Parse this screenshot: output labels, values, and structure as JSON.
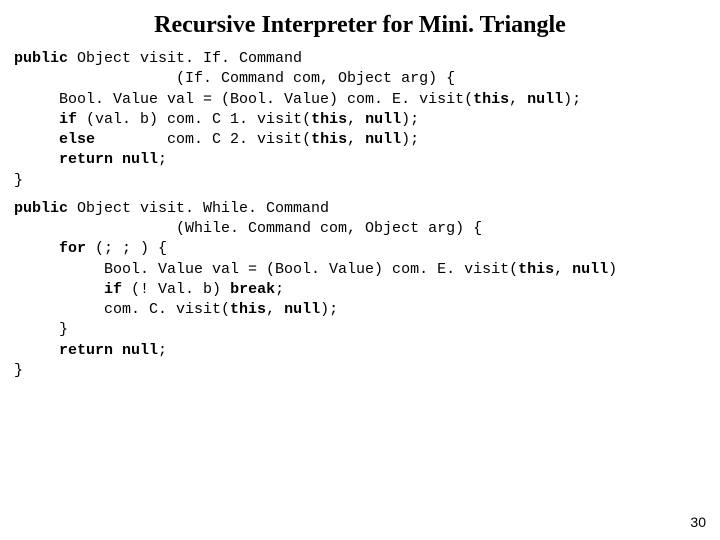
{
  "title": "Recursive Interpreter for Mini. Triangle",
  "code": {
    "ifCmd": {
      "l1a": "public",
      "l1b": " Object visit. If. Command",
      "l2": "                  (If. Command com, Object arg) {",
      "l3a": "     Bool. Value val = (Bool. Value) com. E. visit(",
      "l3b": "this",
      "l3c": ", ",
      "l3d": "null",
      "l3e": ");",
      "l4a": "     ",
      "l4b": "if",
      "l4c": " (val. b) com. C 1. visit(",
      "l4d": "this",
      "l4e": ", ",
      "l4f": "null",
      "l4g": ");",
      "l5a": "     ",
      "l5b": "else",
      "l5c": "        com. C 2. visit(",
      "l5d": "this",
      "l5e": ", ",
      "l5f": "null",
      "l5g": ");",
      "l6a": "     ",
      "l6b": "return null",
      "l6c": ";",
      "l7": "}"
    },
    "whileCmd": {
      "l1a": "public",
      "l1b": " Object visit. While. Command",
      "l2": "                  (While. Command com, Object arg) {",
      "l3a": "     ",
      "l3b": "for",
      "l3c": " (; ; ) {",
      "l4a": "          Bool. Value val = (Bool. Value) com. E. visit(",
      "l4b": "this",
      "l4c": ", ",
      "l4d": "null",
      "l4e": ")",
      "l5a": "          ",
      "l5b": "if",
      "l5c": " (! Val. b) ",
      "l5d": "break",
      "l5e": ";",
      "l6a": "          com. C. visit(",
      "l6b": "this",
      "l6c": ", ",
      "l6d": "null",
      "l6e": ");",
      "l7": "     }",
      "l8a": "     ",
      "l8b": "return null",
      "l8c": ";",
      "l9": "}"
    }
  },
  "pageNumber": "30"
}
